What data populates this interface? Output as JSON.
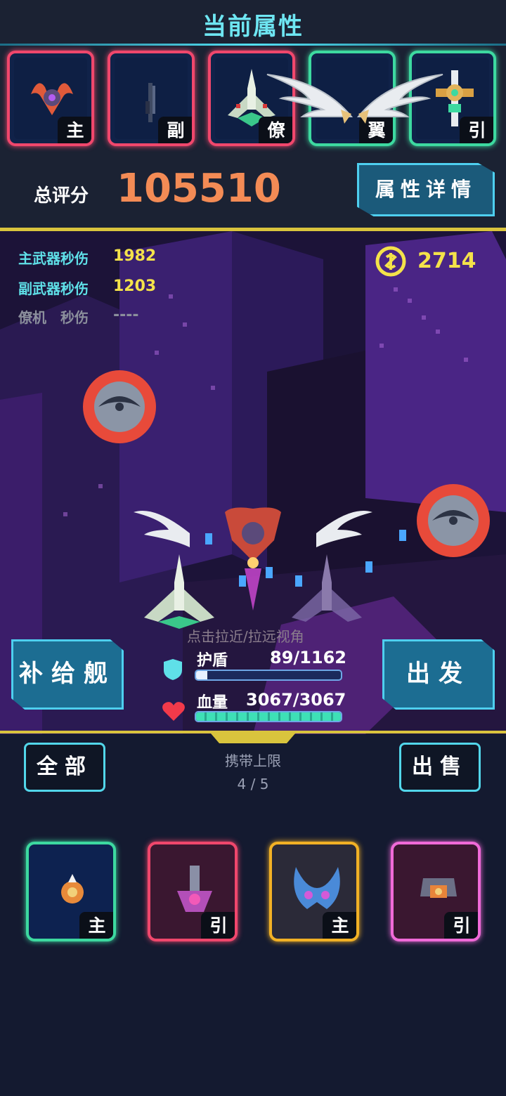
{
  "header": {
    "title": "当前属性",
    "slots": [
      {
        "tag": "主",
        "icon": "main-weapon-ship-icon",
        "color": "#f0476c"
      },
      {
        "tag": "副",
        "icon": "sub-weapon-icon",
        "color": "#f0476c"
      },
      {
        "tag": "僚",
        "icon": "wingman-ship-icon",
        "color": "#f0476c"
      },
      {
        "tag": "翼",
        "icon": "wings-icon",
        "color": "#3dd9a0"
      },
      {
        "tag": "引",
        "icon": "engine-icon",
        "color": "#3dd9a0"
      }
    ],
    "score_label": "总评分",
    "score_value": "105510",
    "detail_button": "属性详情"
  },
  "stats": {
    "main_label": "主武器秒伤",
    "main_value": "1982",
    "sub_label": "副武器秒伤",
    "sub_value": "1203",
    "wingman_label": "僚机　秒伤",
    "wingman_value": "----",
    "coin_value": "2714"
  },
  "scene": {
    "hint": "点击拉近/拉远视角",
    "supply_button": "补给舰",
    "launch_button": "出发",
    "shield_label": "护盾",
    "shield_value": "89/1162",
    "shield_fraction": 0.077,
    "hp_label": "血量",
    "hp_value": "3067/3067",
    "hp_fraction": 1.0
  },
  "inventory": {
    "all_button": "全部",
    "sell_button": "出售",
    "limit_label": "携带上限",
    "limit_value": "4 / 5",
    "cards": [
      {
        "tag": "主",
        "icon": "orange-pod-ship-icon",
        "color": "#3dd9a0"
      },
      {
        "tag": "引",
        "icon": "purple-engine-icon",
        "color": "#f0476c"
      },
      {
        "tag": "主",
        "icon": "blue-claw-ship-icon",
        "color": "#f2b125"
      },
      {
        "tag": "引",
        "icon": "orange-engine-icon",
        "color": "#f06ad8"
      }
    ]
  }
}
